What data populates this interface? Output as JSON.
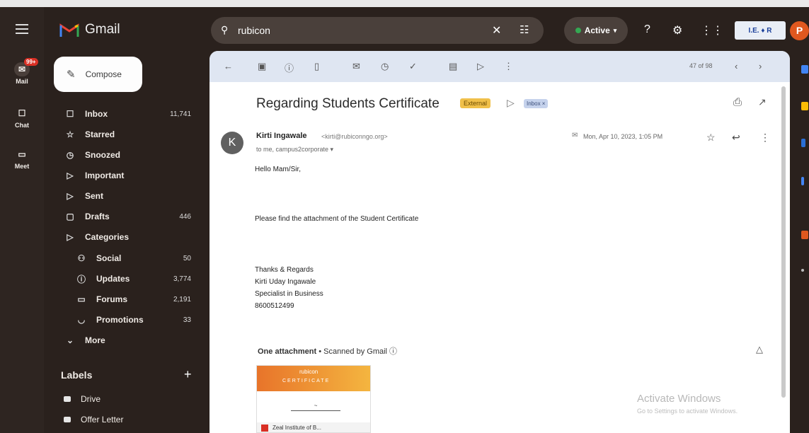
{
  "app": {
    "name": "Gmail"
  },
  "rail": {
    "items": [
      {
        "label": "Mail",
        "badge": "99+"
      },
      {
        "label": "Chat"
      },
      {
        "label": "Meet"
      }
    ]
  },
  "search": {
    "value": "rubicon"
  },
  "status": {
    "label": "Active"
  },
  "header_org_logo": "I.E. ♦ R",
  "account": {
    "initial": "P"
  },
  "compose": {
    "label": "Compose"
  },
  "nav": {
    "items": [
      {
        "label": "Inbox",
        "count": "11,741",
        "icon": "inbox-icon",
        "glyph": "☐"
      },
      {
        "label": "Starred",
        "count": "",
        "icon": "star-icon",
        "glyph": "☆"
      },
      {
        "label": "Snoozed",
        "count": "",
        "icon": "clock-icon",
        "glyph": "◷"
      },
      {
        "label": "Important",
        "count": "",
        "icon": "important-icon",
        "glyph": "▷"
      },
      {
        "label": "Sent",
        "count": "",
        "icon": "send-icon",
        "glyph": "▷"
      },
      {
        "label": "Drafts",
        "count": "446",
        "icon": "draft-icon",
        "glyph": "▢"
      },
      {
        "label": "Categories",
        "count": "",
        "icon": "label-icon",
        "glyph": "▷"
      },
      {
        "label": "Social",
        "count": "50",
        "icon": "people-icon",
        "glyph": "⚇"
      },
      {
        "label": "Updates",
        "count": "3,774",
        "icon": "info-icon",
        "glyph": "ⓘ"
      },
      {
        "label": "Forums",
        "count": "2,191",
        "icon": "forum-icon",
        "glyph": "▭"
      },
      {
        "label": "Promotions",
        "count": "33",
        "icon": "tag-icon",
        "glyph": "◡"
      },
      {
        "label": "More",
        "count": "",
        "icon": "chevron-down-icon",
        "glyph": "⌄"
      }
    ]
  },
  "labels": {
    "title": "Labels",
    "items": [
      {
        "label": "Drive"
      },
      {
        "label": "Offer Letter"
      }
    ]
  },
  "toolbar": {
    "count": "47 of 98"
  },
  "email": {
    "subject": "Regarding Students Certificate",
    "external_badge": "External",
    "inbox_chip": "Inbox ×",
    "sender_initial": "K",
    "sender_name": "Kirti Ingawale",
    "sender_email": "<kirti@rubiconngo.org>",
    "to": "to me, campus2corporate ▾",
    "date": "Mon, Apr 10, 2023, 1:05 PM",
    "greeting": "Hello Mam/Sir,",
    "body": "Please find the attachment of the Student Certificate",
    "signature": [
      "Thanks & Regards",
      "Kirti Uday Ingawale",
      "Specialist in Business",
      "8600512499"
    ],
    "attachment_count": "One attachment",
    "attachment_scan": "• Scanned by Gmail ⓘ",
    "thumb_brand": "rubicon",
    "thumb_title": "CERTIFICATE",
    "thumb_file": "Zeal Institute of B..."
  },
  "watermark": {
    "title": "Activate Windows",
    "subtitle": "Go to Settings to activate Windows."
  }
}
